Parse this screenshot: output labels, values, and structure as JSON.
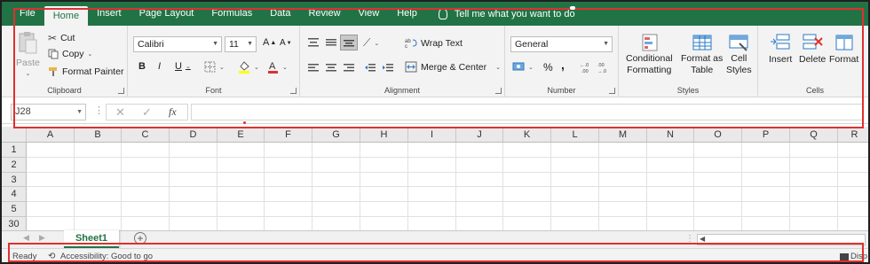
{
  "tabs": [
    "File",
    "Home",
    "Insert",
    "Page Layout",
    "Formulas",
    "Data",
    "Review",
    "View",
    "Help"
  ],
  "tell_me": "Tell me what you want to do",
  "clipboard": {
    "paste": "Paste",
    "cut": "Cut",
    "copy": "Copy",
    "format_painter": "Format Painter",
    "label": "Clipboard"
  },
  "font": {
    "name": "Calibri",
    "size": "11",
    "bold": "B",
    "italic": "I",
    "underline": "U",
    "grow": "A",
    "shrink": "A",
    "label": "Font"
  },
  "alignment": {
    "wrap_text": "Wrap Text",
    "merge_center": "Merge & Center",
    "label": "Alignment"
  },
  "number": {
    "format": "General",
    "percent": "%",
    "comma": ",",
    "label": "Number"
  },
  "styles": {
    "conditional_1": "Conditional",
    "conditional_2": "Formatting",
    "format_as_1": "Format as",
    "format_as_2": "Table",
    "cell_1": "Cell",
    "cell_2": "Styles",
    "label": "Styles"
  },
  "cells": {
    "insert": "Insert",
    "delete": "Delete",
    "format": "Format",
    "label": "Cells"
  },
  "formula_bar": {
    "name_box": "J28",
    "fx": "fx"
  },
  "columns": [
    "A",
    "B",
    "C",
    "D",
    "E",
    "F",
    "G",
    "H",
    "I",
    "J",
    "K",
    "L",
    "M",
    "N",
    "O",
    "P",
    "Q",
    "R"
  ],
  "rows": [
    "1",
    "2",
    "3",
    "4",
    "5",
    "30"
  ],
  "sheet_tab": "Sheet1",
  "status": {
    "ready": "Ready",
    "accessibility": "Accessibility: Good to go",
    "display": "Disp"
  },
  "colors": {
    "brand": "#217346",
    "highlight_box": "#e0302f"
  }
}
